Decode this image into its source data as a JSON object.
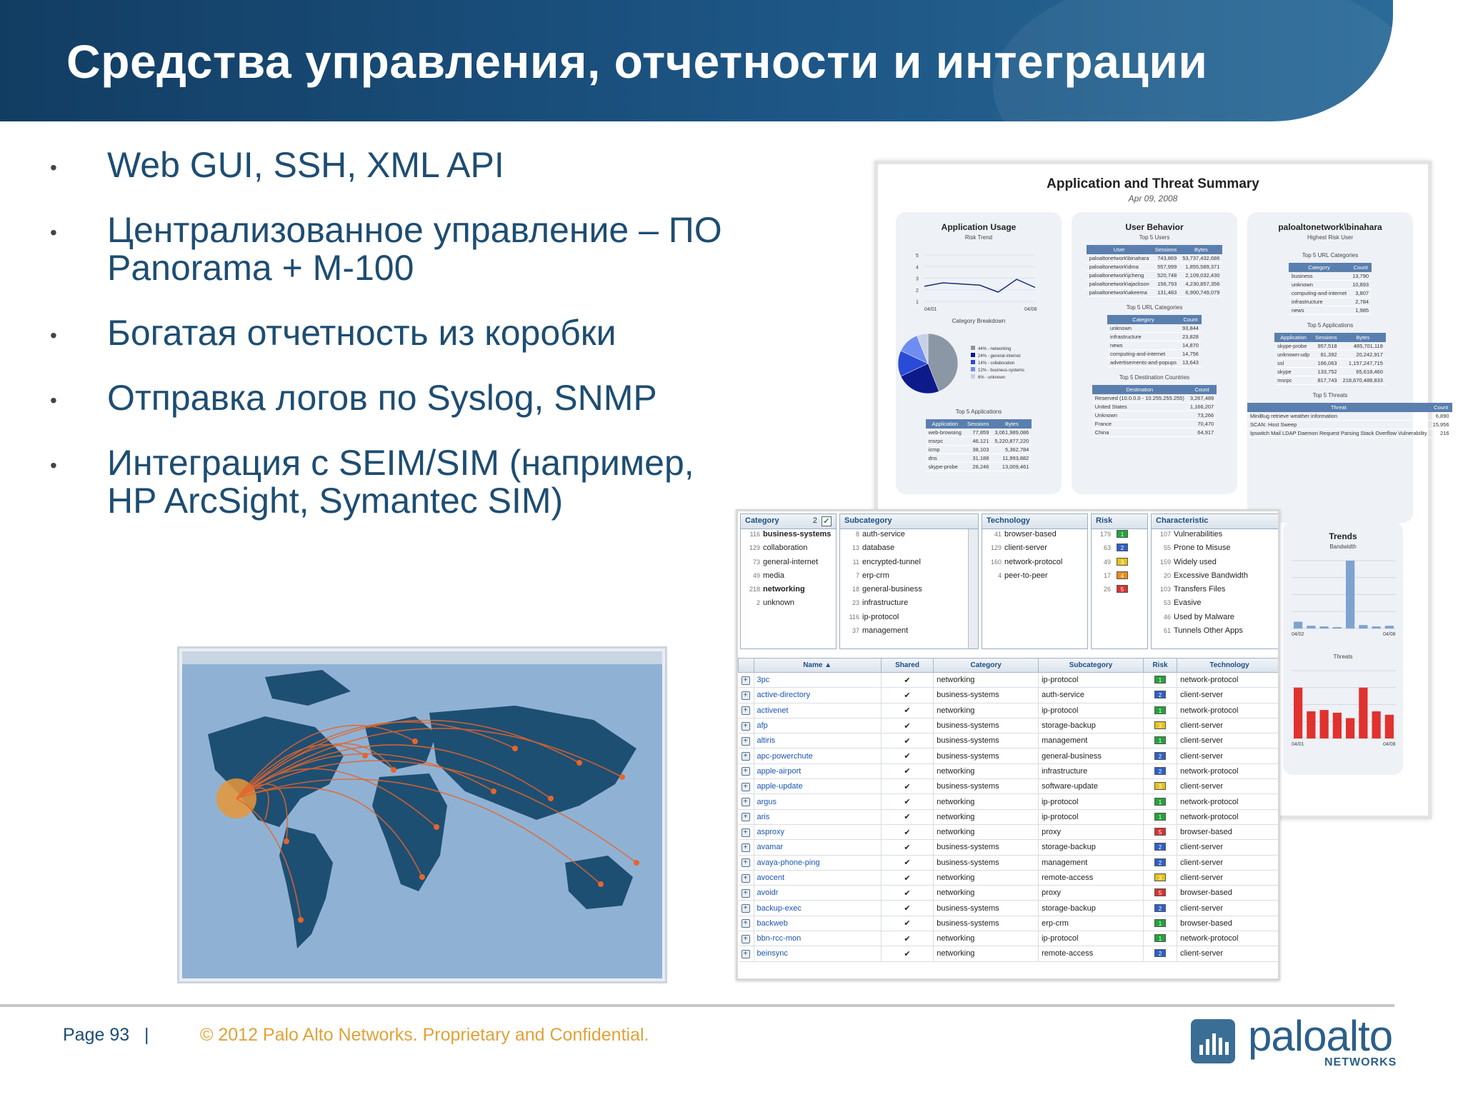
{
  "slide": {
    "title": "Средства управления, отчетности и интеграции",
    "bullets": [
      {
        "line1": "Web GUI, SSH, XML API",
        "line2": ""
      },
      {
        "line1": "Централизованное управление – ПО",
        "line2": "Panorama + M-100"
      },
      {
        "line1": "Богатая отчетность из коробки",
        "line2": ""
      },
      {
        "line1": "Отправка логов по Syslog, SNMP",
        "line2": ""
      },
      {
        "line1": "Интеграция с SEIM/SIM (например,",
        "line2": "HP ArcSight,     Symantec SIM)"
      }
    ],
    "bullet_char": "•"
  },
  "report": {
    "title": "Application and Threat Summary",
    "date": "Apr 09, 2008",
    "app_usage": {
      "title": "Application Usage",
      "risk_trend_label": "Risk Trend",
      "risk_trend": {
        "x_start": "04/01",
        "x_end": "04/08",
        "y_ticks": [
          "5",
          "4",
          "3",
          "2",
          "1"
        ],
        "values": [
          2.3,
          2.6,
          2.5,
          2.4,
          1.8,
          2.9,
          2.2
        ]
      },
      "breakdown_title": "Category Breakdown",
      "breakdown": [
        {
          "label": "44% - networking",
          "value": 44,
          "color": "#8c97a6"
        },
        {
          "label": "24% - general-internet",
          "value": 24,
          "color": "#0d1a8a"
        },
        {
          "label": "14% - collaboration",
          "value": 14,
          "color": "#2a4bd7"
        },
        {
          "label": "12% - business-systems",
          "value": 12,
          "color": "#6f8df0"
        },
        {
          "label": "6% - unknown",
          "value": 6,
          "color": "#c7d1e4"
        }
      ],
      "top_apps_title": "Top 5 Applications",
      "top_apps_cols": [
        "Application",
        "Sessions",
        "Bytes"
      ],
      "top_apps": [
        [
          "web-browsing",
          "77,859",
          "3,061,989,086"
        ],
        [
          "msrpc",
          "46,121",
          "5,220,877,220"
        ],
        [
          "icmp",
          "38,103",
          "5,362,784"
        ],
        [
          "dns",
          "31,188",
          "11,993,882"
        ],
        [
          "skype-probe",
          "28,246",
          "13,009,461"
        ]
      ]
    },
    "user_behavior": {
      "title": "User Behavior",
      "top_users_title": "Top 5 Users",
      "top_users_cols": [
        "User",
        "Sessions",
        "Bytes"
      ],
      "top_users": [
        [
          "paloaltonetwork\\binahara",
          "743,869",
          "53,737,432,686"
        ],
        [
          "paloaltonetwork\\dma",
          "557,999",
          "1,855,589,371"
        ],
        [
          "paloaltonetwork\\jcheng",
          "520,748",
          "2,109,032,430"
        ],
        [
          "paloaltonetwork\\ajackson",
          "156,793",
          "4,230,857,356"
        ],
        [
          "paloaltonetwork\\akeema",
          "131,483",
          "6,900,749,079"
        ]
      ],
      "url_title": "Top 5 URL Categories",
      "url_cols": [
        "Category",
        "Count"
      ],
      "url": [
        [
          "unknown",
          "93,844"
        ],
        [
          "infrastructure",
          "23,828"
        ],
        [
          "news",
          "14,870"
        ],
        [
          "computing-and-internet",
          "14,756"
        ],
        [
          "advertisements-and-popups",
          "13,643"
        ]
      ],
      "dest_title": "Top 5 Destination Countries",
      "dest_cols": [
        "Destination",
        "Count"
      ],
      "dest": [
        [
          "Reserved (10.0.0.0 - 10.255.255.255)",
          "3,267,489"
        ],
        [
          "United States",
          "1,166,207"
        ],
        [
          "Unknown",
          "73,266"
        ],
        [
          "France",
          "70,470"
        ],
        [
          "China",
          "64,917"
        ]
      ]
    },
    "risk_user": {
      "title": "paloaltonetwork\\binahara",
      "subtitle": "Highest Risk User",
      "url_title": "Top 5 URL Categories",
      "url_cols": [
        "Category",
        "Count"
      ],
      "url": [
        [
          "business",
          "13,790"
        ],
        [
          "unknown",
          "10,893"
        ],
        [
          "computing-and-internet",
          "3,807"
        ],
        [
          "infrastructure",
          "2,784"
        ],
        [
          "news",
          "1,985"
        ]
      ],
      "apps_title": "Top 5 Applications",
      "apps_cols": [
        "Application",
        "Sessions",
        "Bytes"
      ],
      "apps": [
        [
          "skype-probe",
          "957,518",
          "485,701,118"
        ],
        [
          "unknown-udp",
          "81,392",
          "20,242,917"
        ],
        [
          "ssl",
          "166,063",
          "1,157,247,715"
        ],
        [
          "skype",
          "133,752",
          "65,618,460"
        ],
        [
          "msrpc",
          "817,743",
          "218,670,488,833"
        ]
      ],
      "threats_title": "Top 5 Threats",
      "threats_cols": [
        "Threat",
        "Count"
      ],
      "threats": [
        [
          "MiniBug retrieve weather information",
          "6,890"
        ],
        [
          "SCAN: Host Sweep",
          "15,956"
        ],
        [
          "Ipswitch Mail LDAP Daemon Request Parsing Stack Overflow Vulnerability",
          "216"
        ]
      ]
    },
    "trends": {
      "title": "Trends",
      "bandwidth_label": "Bandwidth",
      "bandwidth": [
        10,
        4,
        3,
        2,
        100,
        5,
        3,
        4
      ],
      "bandwidth_x": [
        "04/02",
        "04/08"
      ],
      "threats_label": "Threats",
      "threats": [
        75,
        40,
        42,
        38,
        30,
        75,
        40,
        35
      ],
      "threats_x": [
        "04/01",
        "04/08"
      ]
    }
  },
  "browser": {
    "filters": {
      "category": {
        "title": "Category",
        "count": "2",
        "items": [
          [
            "116",
            "business-systems",
            true
          ],
          [
            "129",
            "collaboration",
            false
          ],
          [
            "73",
            "general-internet",
            false
          ],
          [
            "49",
            "media",
            false
          ],
          [
            "218",
            "networking",
            true
          ],
          [
            "2",
            "unknown",
            false
          ]
        ]
      },
      "subcategory": {
        "title": "Subcategory",
        "items": [
          [
            "8",
            "auth-service"
          ],
          [
            "13",
            "database"
          ],
          [
            "11",
            "encrypted-tunnel"
          ],
          [
            "7",
            "erp-crm"
          ],
          [
            "18",
            "general-business"
          ],
          [
            "23",
            "infrastructure"
          ],
          [
            "116",
            "ip-protocol"
          ],
          [
            "37",
            "management"
          ]
        ]
      },
      "technology": {
        "title": "Technology",
        "items": [
          [
            "41",
            "browser-based"
          ],
          [
            "129",
            "client-server"
          ],
          [
            "160",
            "network-protocol"
          ],
          [
            "4",
            "peer-to-peer"
          ]
        ]
      },
      "risk": {
        "title": "Risk",
        "items": [
          [
            "179",
            "1",
            "#24a23a"
          ],
          [
            "63",
            "2",
            "#2f5fc6"
          ],
          [
            "49",
            "3",
            "#e6c21c"
          ],
          [
            "17",
            "4",
            "#ef8a1e"
          ],
          [
            "26",
            "5",
            "#d83232"
          ]
        ]
      },
      "characteristic": {
        "title": "Characteristic",
        "items": [
          [
            "107",
            "Vulnerabilities"
          ],
          [
            "55",
            "Prone to Misuse"
          ],
          [
            "159",
            "Widely used"
          ],
          [
            "20",
            "Excessive Bandwidth"
          ],
          [
            "103",
            "Transfers Files"
          ],
          [
            "53",
            "Evasive"
          ],
          [
            "46",
            "Used by Malware"
          ],
          [
            "61",
            "Tunnels Other Apps"
          ]
        ]
      }
    },
    "grid_cols": [
      "Name ▲",
      "Shared",
      "Category",
      "Subcategory",
      "Risk",
      "Technology"
    ],
    "grid_rows": [
      [
        "3pc",
        "✔",
        "networking",
        "ip-protocol",
        "1",
        "network-protocol"
      ],
      [
        "active-directory",
        "✔",
        "business-systems",
        "auth-service",
        "2",
        "client-server"
      ],
      [
        "activenet",
        "✔",
        "networking",
        "ip-protocol",
        "1",
        "network-protocol"
      ],
      [
        "afp",
        "✔",
        "business-systems",
        "storage-backup",
        "3",
        "client-server"
      ],
      [
        "altiris",
        "✔",
        "business-systems",
        "management",
        "1",
        "client-server"
      ],
      [
        "apc-powerchute",
        "✔",
        "business-systems",
        "general-business",
        "2",
        "client-server"
      ],
      [
        "apple-airport",
        "✔",
        "networking",
        "infrastructure",
        "2",
        "network-protocol"
      ],
      [
        "apple-update",
        "✔",
        "business-systems",
        "software-update",
        "3",
        "client-server"
      ],
      [
        "argus",
        "✔",
        "networking",
        "ip-protocol",
        "1",
        "network-protocol"
      ],
      [
        "aris",
        "✔",
        "networking",
        "ip-protocol",
        "1",
        "network-protocol"
      ],
      [
        "asproxy",
        "✔",
        "networking",
        "proxy",
        "5",
        "browser-based"
      ],
      [
        "avamar",
        "✔",
        "business-systems",
        "storage-backup",
        "2",
        "client-server"
      ],
      [
        "avaya-phone-ping",
        "✔",
        "business-systems",
        "management",
        "2",
        "client-server"
      ],
      [
        "avocent",
        "✔",
        "networking",
        "remote-access",
        "3",
        "client-server"
      ],
      [
        "avoidr",
        "✔",
        "networking",
        "proxy",
        "5",
        "browser-based"
      ],
      [
        "backup-exec",
        "✔",
        "business-systems",
        "storage-backup",
        "2",
        "client-server"
      ],
      [
        "backweb",
        "✔",
        "business-systems",
        "erp-crm",
        "1",
        "browser-based"
      ],
      [
        "bbn-rcc-mon",
        "✔",
        "networking",
        "ip-protocol",
        "1",
        "network-protocol"
      ],
      [
        "beinsync",
        "✔",
        "networking",
        "remote-access",
        "2",
        "client-server"
      ]
    ],
    "risk_colors": {
      "1": "#24a23a",
      "2": "#2f5fc6",
      "3": "#e6c21c",
      "4": "#ef8a1e",
      "5": "#d83232"
    }
  },
  "footer": {
    "page": "Page 93",
    "separator": "|",
    "copyright": "© 2012 Palo Alto Networks. Proprietary and Confidential.",
    "logo_word": "paloalto",
    "logo_sub": "NETWORKS"
  },
  "colors": {
    "header": "#1d5584",
    "text": "#1e4d72",
    "copyright": "#e0a23a",
    "accent": "#2c5f8a"
  }
}
